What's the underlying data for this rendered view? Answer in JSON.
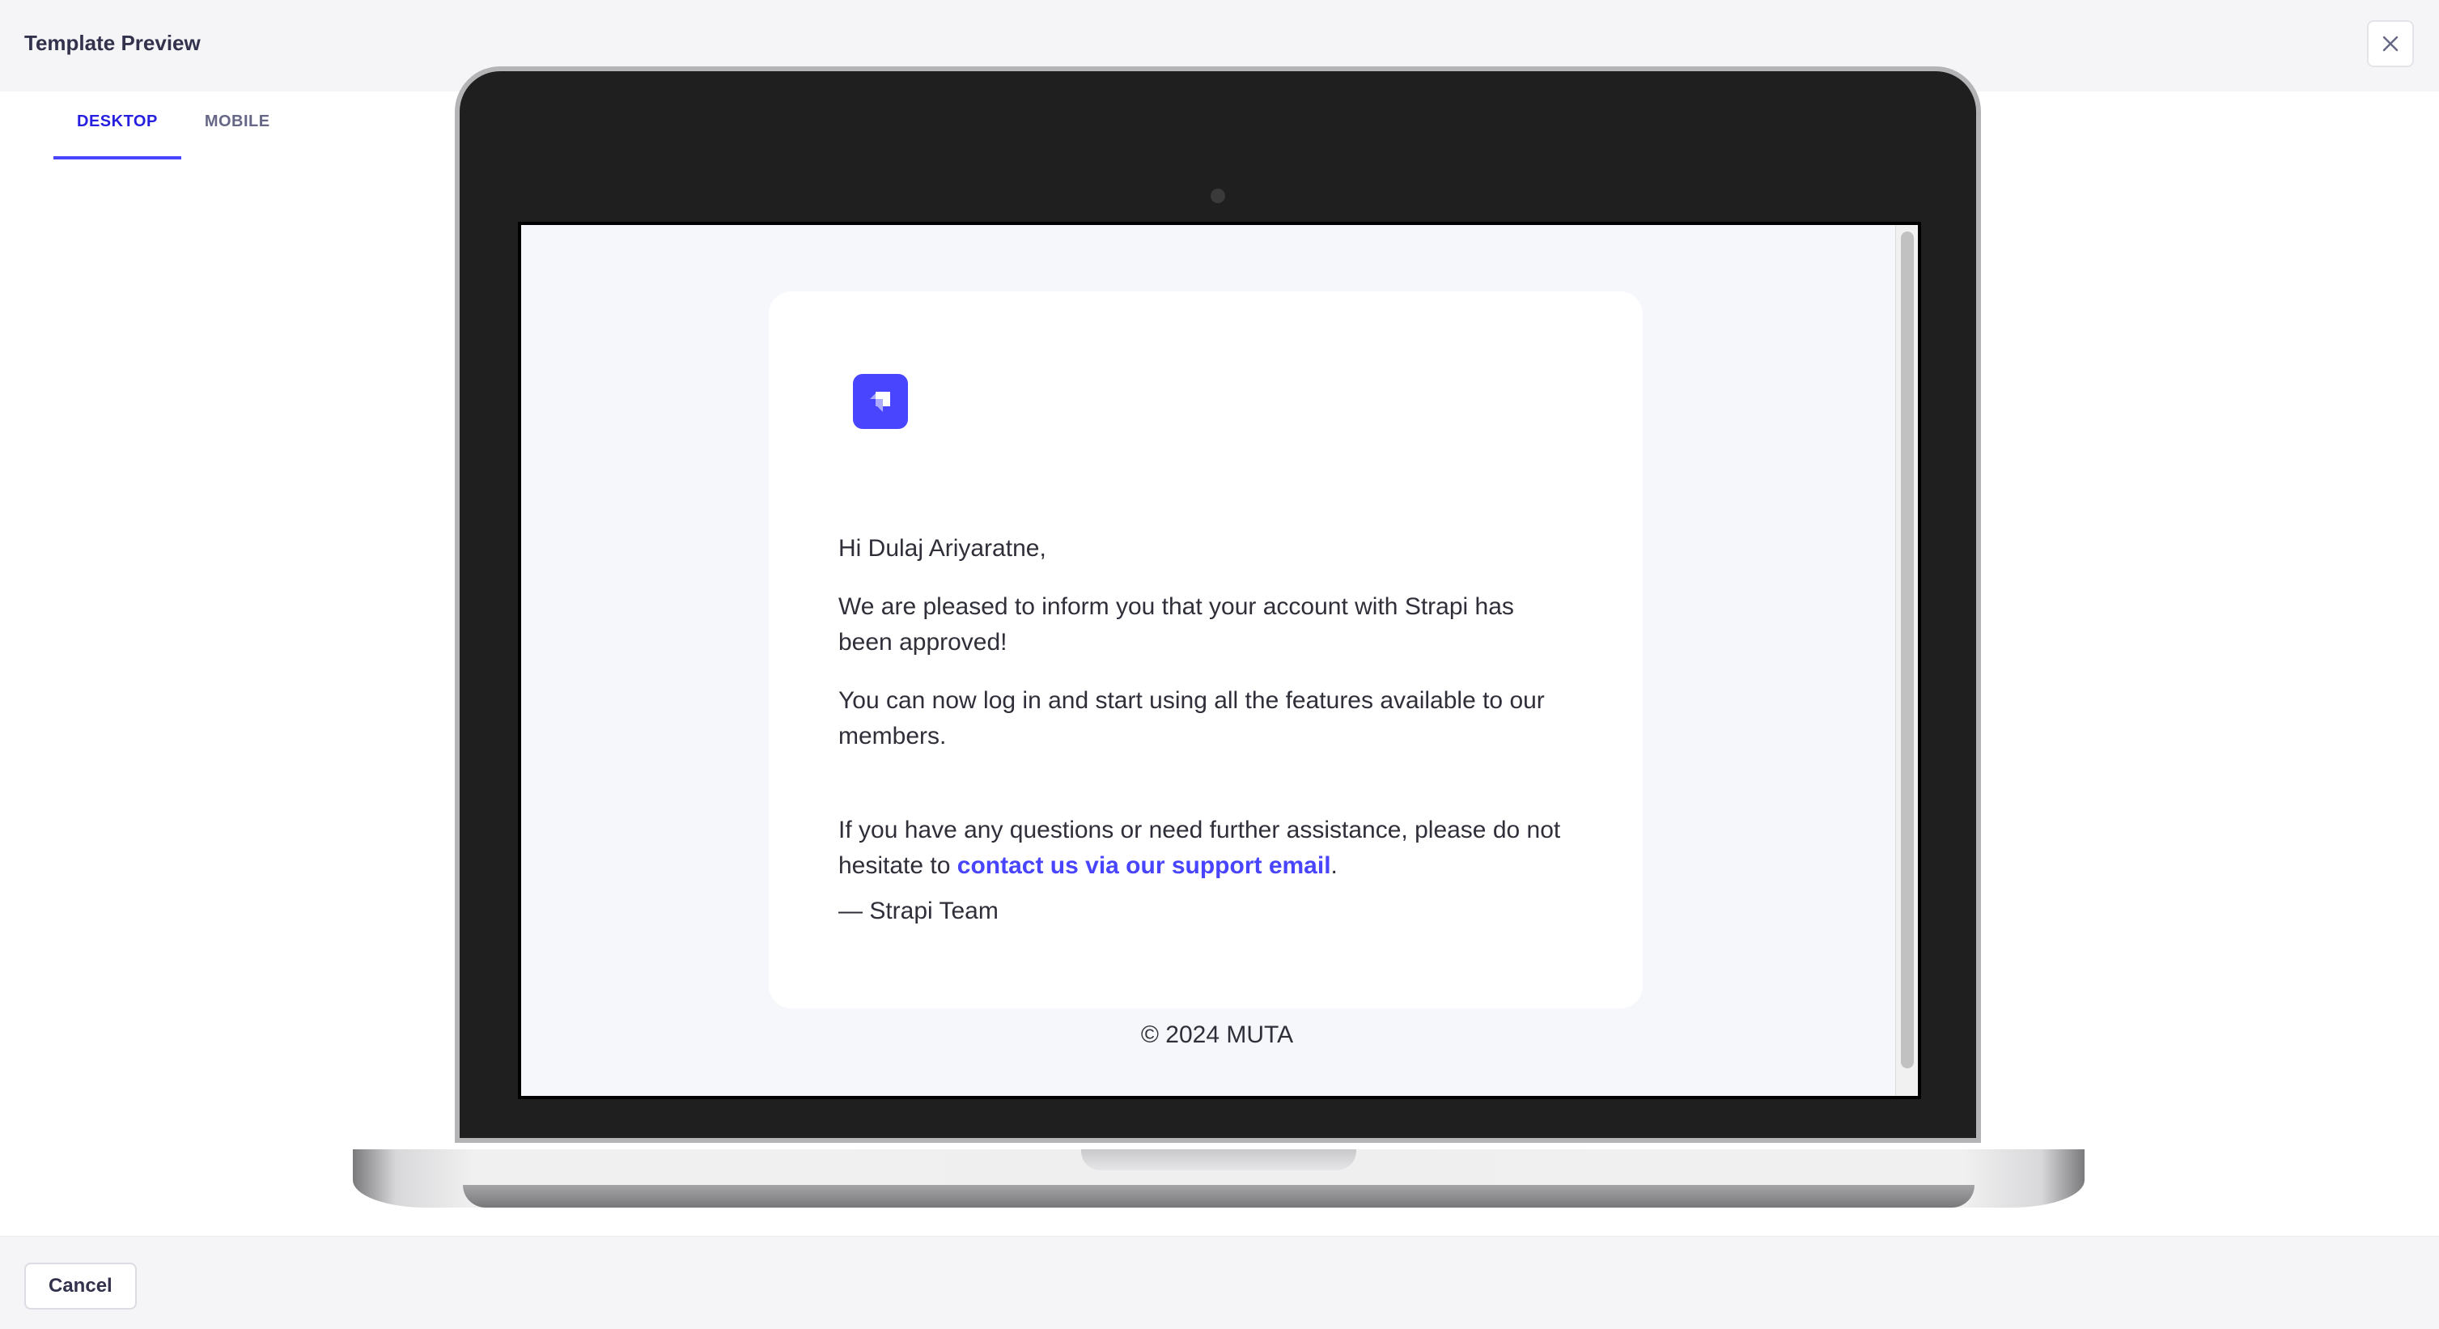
{
  "header": {
    "title": "Template Preview",
    "close_icon": "close-icon"
  },
  "tabs": [
    {
      "label": "DESKTOP",
      "active": true
    },
    {
      "label": "MOBILE",
      "active": false
    }
  ],
  "email": {
    "logo_icon": "strapi-logo-icon",
    "greeting": "Hi Dulaj Ariyaratne,",
    "paragraph1": "We are pleased to inform you that your account with Strapi has been approved!",
    "paragraph2": "You can now log in and start using all the features available to our members.",
    "paragraph3_before": "If you have any questions or need further assistance, please do not hesitate to ",
    "paragraph3_link": "contact us via our support email",
    "paragraph3_after": ".",
    "signature": "— Strapi Team",
    "copyright": "© 2024 MUTA"
  },
  "footer": {
    "cancel_label": "Cancel"
  },
  "colors": {
    "accent": "#4945ff",
    "tab_active": "#271fe0"
  }
}
